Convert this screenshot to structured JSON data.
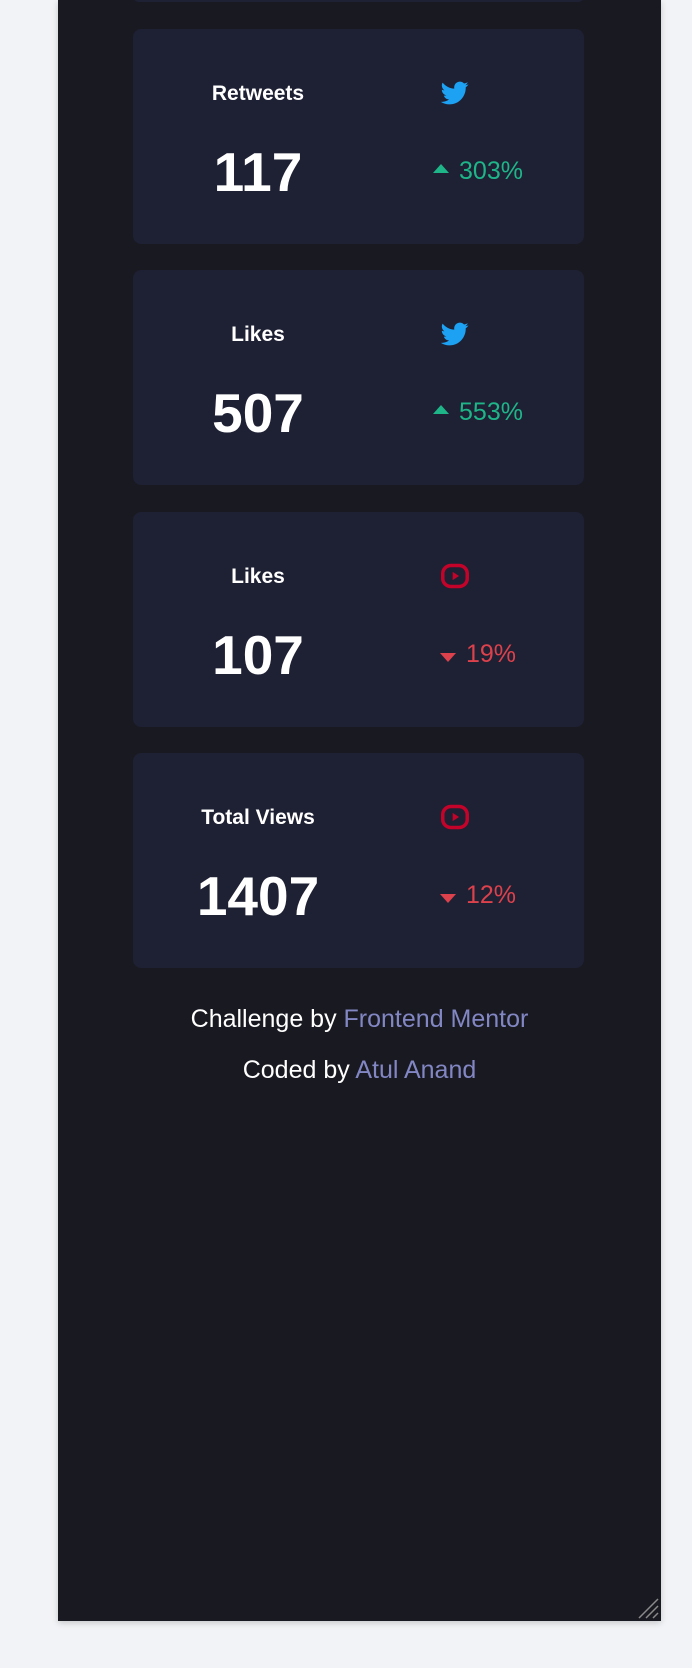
{
  "cards": [
    {
      "label": "Retweets",
      "icon": "twitter-icon",
      "value": "117",
      "change": "303%",
      "direction": "up"
    },
    {
      "label": "Likes",
      "icon": "twitter-icon",
      "value": "507",
      "change": "553%",
      "direction": "up"
    },
    {
      "label": "Likes",
      "icon": "youtube-icon",
      "value": "107",
      "change": "19%",
      "direction": "down"
    },
    {
      "label": "Total Views",
      "icon": "youtube-icon",
      "value": "1407",
      "change": "12%",
      "direction": "down"
    }
  ],
  "footer": {
    "challenge_prefix": "Challenge by",
    "challenge_link": "Frontend Mentor",
    "coded_prefix": "Coded by",
    "coded_link": "Atul Anand"
  },
  "colors": {
    "background": "#191921",
    "card": "#1e2033",
    "up": "#1eb589",
    "down": "#dc414c",
    "twitter": "#1da1f2",
    "youtube": "#c4032a",
    "link": "#8287c4"
  }
}
